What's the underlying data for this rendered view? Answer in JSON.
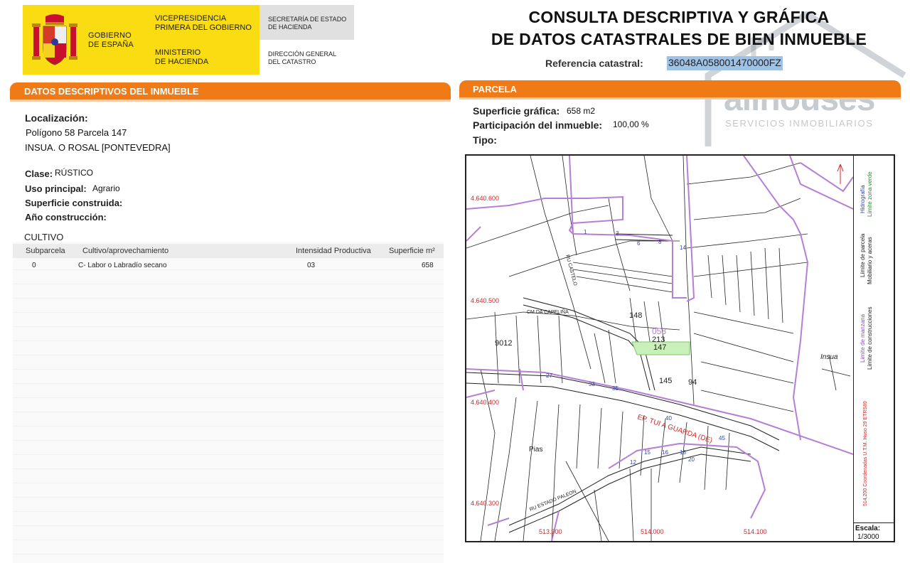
{
  "header": {
    "gobierno": [
      "GOBIERNO",
      "DE ESPAÑA"
    ],
    "vicepresidencia": [
      "VICEPRESIDENCIA",
      "PRIMERA DEL GOBIERNO"
    ],
    "ministerio": [
      "MINISTERIO",
      "DE HACIENDA"
    ],
    "secretaria": [
      "SECRETARÍA DE ESTADO",
      "DE HACIENDA"
    ],
    "direccion": [
      "DIRECCIÓN GENERAL",
      "DEL CATASTRO"
    ],
    "title_line1": "CONSULTA DESCRIPTIVA Y GRÁFICA",
    "title_line2": "DE DATOS CATASTRALES DE BIEN INMUEBLE",
    "ref_label": "Referencia catastral:",
    "ref_value": "36048A058001470000FZ",
    "brand_color": "#f07a16",
    "logo_yellow": "#fadc12"
  },
  "watermark": {
    "name": "allhouses",
    "tagline": "SERVICIOS INMOBILIARIOS"
  },
  "descriptivos": {
    "section_title": "DATOS DESCRIPTIVOS DEL INMUEBLE",
    "localizacion_label": "Localización:",
    "localizacion_line1": "Polígono 58 Parcela 147",
    "localizacion_line2": "INSUA. O ROSAL [PONTEVEDRA]",
    "clase_label": "Clase:",
    "clase_value": "RÚSTICO",
    "uso_label": "Uso principal:",
    "uso_value": "Agrario",
    "superficie_label": "Superficie construida:",
    "anio_label": "Año construcción:",
    "cultivo_title": "CULTIVO",
    "columns": [
      "Subparcela",
      "Cultivo/aprovechamiento",
      "Intensidad Productiva",
      "Superficie m²"
    ],
    "rows": [
      {
        "subparcela": "0",
        "cultivo": "C- Labor o Labradío secano",
        "intensidad": "03",
        "superficie": "658"
      }
    ]
  },
  "parcela": {
    "section_title": "PARCELA",
    "superficie_label": "Superficie gráfica:",
    "superficie_value": "658 m2",
    "participacion_label": "Participación del inmueble:",
    "participacion_value": "100,00 %",
    "tipo_label": "Tipo:"
  },
  "map": {
    "y_coords": [
      "4.640.600",
      "4.640.500",
      "4.640.400",
      "4.640.300"
    ],
    "x_coords": [
      "513.900",
      "514.000",
      "514.100"
    ],
    "parcel_labels": [
      "148",
      "213",
      "147",
      "145",
      "9012",
      "058",
      "94"
    ],
    "place_labels": [
      "Insua",
      "Pias"
    ],
    "road_label": "EP. TUI A GUARDA (DE)",
    "street_labels": [
      "CM DA CAPELIÑA",
      "RU CASTELO",
      "RU ESTADO PALEON"
    ],
    "number_labels": [
      "27",
      "33",
      "35",
      "40",
      "45",
      "15",
      "16",
      "18",
      "20",
      "12",
      "14",
      "6",
      "8",
      "1",
      "3"
    ],
    "legend": [
      "Límite de manzana",
      "Límite de construcciones",
      "Límite de parcela",
      "Mobiliario y aceras",
      "Hidrografía",
      "Límite zona verde"
    ],
    "coord_system": "514,200 Coordenadas U.T.M. Huso 29 ETRS89",
    "scale_label": "Escala:",
    "scale_value": "1/3000",
    "colors": {
      "manzana": "#b57fd6",
      "highlight": "#c9f0b8",
      "coords": "#cc2a2a",
      "numbers": "#3344aa"
    }
  }
}
